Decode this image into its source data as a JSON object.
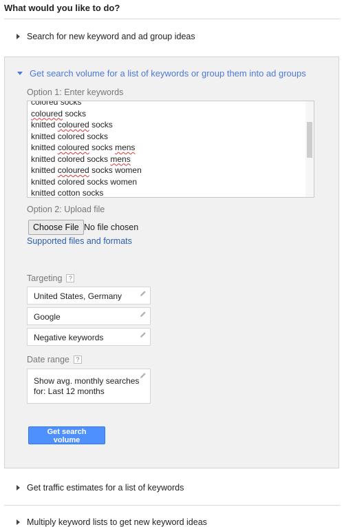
{
  "heading": "What would you like to do?",
  "sections": {
    "search_new": "Search for new keyword and ad group ideas",
    "get_volume": "Get search volume for a list of keywords or group them into ad groups",
    "traffic": "Get traffic estimates for a list of keywords",
    "multiply": "Multiply keyword lists to get new keyword ideas"
  },
  "option1": {
    "label": "Option 1: Enter keywords",
    "keywords": [
      "colored socks",
      "coloured socks",
      "knitted coloured socks",
      "knitted colored socks",
      "knitted coloured socks mens",
      "knitted colored socks mens",
      "knitted coloured socks women",
      "knitted colored socks women",
      "knitted cotton socks"
    ],
    "kw_parts": {
      "k1": "colored socks",
      "k2a": "coloured",
      "k2b": " socks",
      "k3a": "knitted ",
      "k3b": "coloured",
      "k3c": " socks",
      "k4": "knitted colored socks",
      "k5a": "knitted ",
      "k5b": "coloured",
      "k5c": " socks ",
      "k5d": "mens",
      "k6a": "knitted colored socks ",
      "k6b": "mens",
      "k7a": "knitted ",
      "k7b": "coloured",
      "k7c": " socks women",
      "k8": "knitted colored socks women",
      "k9": "knitted cotton socks"
    }
  },
  "option2": {
    "label": "Option 2: Upload file",
    "choose_button": "Choose File",
    "no_file": "No file chosen",
    "supported_link": "Supported files and formats"
  },
  "targeting": {
    "label": "Targeting",
    "help": "?",
    "location": "United States, Germany",
    "network": "Google",
    "negative": "Negative keywords"
  },
  "date_range": {
    "label": "Date range",
    "help": "?",
    "line1": "Show avg. monthly searches",
    "line2": "for: Last 12 months"
  },
  "submit_button": "Get search volume",
  "colors": {
    "accent": "#4d78d8",
    "link": "#2a5db0",
    "button": "#4d90fe",
    "panel_bg": "#f1f1f1"
  }
}
